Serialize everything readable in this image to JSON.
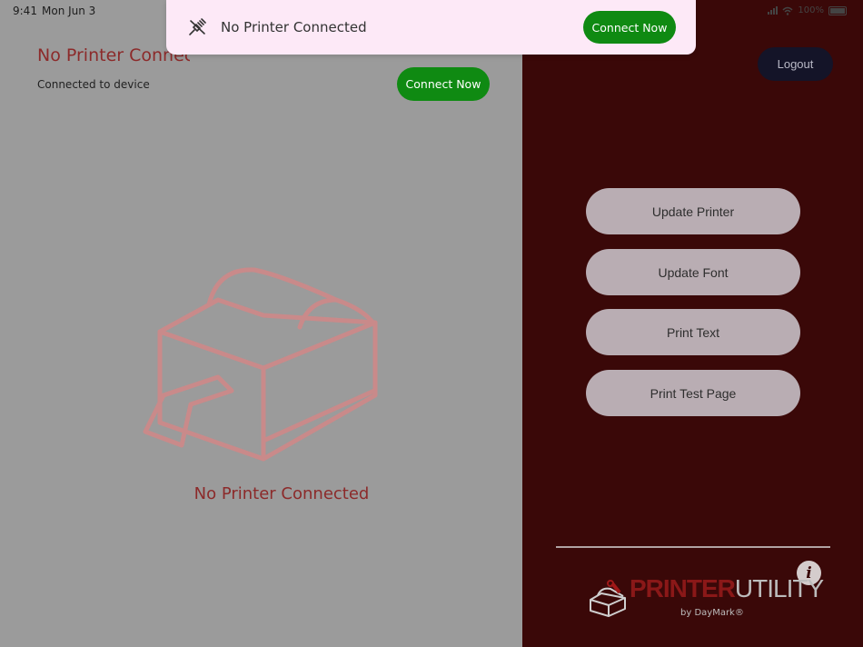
{
  "status_bar": {
    "time": "9:41",
    "date": "Mon Jun 3",
    "battery": "100%"
  },
  "left_panel": {
    "title": "No Printer Connected",
    "subtitle": "Connected to device",
    "connect_button": "Connect Now",
    "empty_state_label": "No Printer Connected",
    "illustration_icon": "printer-outline-icon"
  },
  "right_panel": {
    "logout_button": "Logout",
    "actions": [
      "Update Printer",
      "Update Font",
      "Print Text",
      "Print Test Page"
    ],
    "logo": {
      "part1": "PRINTER",
      "part2": "UTILITY",
      "byline": "by DayMark®"
    },
    "info_icon": "info-icon"
  },
  "banner": {
    "icon": "plug-disconnected-icon",
    "message": "No Printer Connected",
    "connect_button": "Connect Now"
  },
  "colors": {
    "accent_green": "#0f8a12",
    "sidebar_background": "#3a0808",
    "brand_red": "#8a1818",
    "banner_background": "#fde9f7"
  }
}
